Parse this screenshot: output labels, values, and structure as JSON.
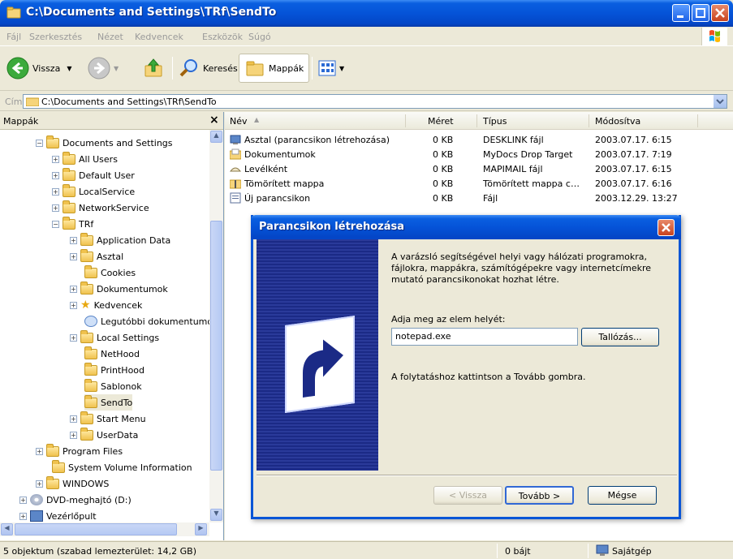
{
  "window": {
    "title": "C:\\Documents and Settings\\TRf\\SendTo"
  },
  "menu": [
    "Fájl",
    "Szerkesztés",
    "Nézet",
    "Kedvencek",
    "Eszközök",
    "Súgó"
  ],
  "toolbar": {
    "back_label": "Vissza",
    "search_label": "Keresés",
    "folders_label": "Mappák"
  },
  "address": {
    "label": "Cím",
    "value": "C:\\Documents and Settings\\TRf\\SendTo"
  },
  "left_pane": {
    "title": "Mappák",
    "close": "×",
    "tree": [
      {
        "label": "Documents and Settings",
        "expander": "−"
      },
      {
        "label": "All Users",
        "expander": "+"
      },
      {
        "label": "Default User",
        "expander": "+"
      },
      {
        "label": "LocalService",
        "expander": "+"
      },
      {
        "label": "NetworkService",
        "expander": "+"
      },
      {
        "label": "TRf",
        "expander": "−"
      },
      {
        "label": "Application Data",
        "expander": "+"
      },
      {
        "label": "Asztal",
        "expander": "+"
      },
      {
        "label": "Cookies",
        "expander": ""
      },
      {
        "label": "Dokumentumok",
        "expander": "+"
      },
      {
        "label": "Kedvencek",
        "expander": "+"
      },
      {
        "label": "Legutóbbi dokumentumo",
        "expander": ""
      },
      {
        "label": "Local Settings",
        "expander": "+"
      },
      {
        "label": "NetHood",
        "expander": ""
      },
      {
        "label": "PrintHood",
        "expander": ""
      },
      {
        "label": "Sablonok",
        "expander": ""
      },
      {
        "label": "SendTo",
        "expander": ""
      },
      {
        "label": "Start Menu",
        "expander": "+"
      },
      {
        "label": "UserData",
        "expander": "+"
      },
      {
        "label": "Program Files",
        "expander": "+"
      },
      {
        "label": "System Volume Information",
        "expander": ""
      },
      {
        "label": "WINDOWS",
        "expander": "+"
      },
      {
        "label": "DVD-meghajtó (D:)",
        "expander": "+"
      },
      {
        "label": "Vezérlőpult",
        "expander": "+"
      }
    ]
  },
  "file_list": {
    "columns": {
      "name": "Név",
      "size": "Méret",
      "type": "Típus",
      "modified": "Módosítva"
    },
    "rows": [
      {
        "name": "Asztal (parancsikon létrehozása)",
        "size": "0 KB",
        "type": "DESKLINK fájl",
        "modified": "2003.07.17. 6:15"
      },
      {
        "name": "Dokumentumok",
        "size": "0 KB",
        "type": "MyDocs Drop Target",
        "modified": "2003.07.17. 7:19"
      },
      {
        "name": "Levélként",
        "size": "0 KB",
        "type": "MAPIMAIL fájl",
        "modified": "2003.07.17. 6:15"
      },
      {
        "name": "Tömörített mappa",
        "size": "0 KB",
        "type": "Tömörített mappa c…",
        "modified": "2003.07.17. 6:16"
      },
      {
        "name": "Új parancsikon",
        "size": "0 KB",
        "type": "Fájl",
        "modified": "2003.12.29. 13:27"
      }
    ]
  },
  "dialog": {
    "title": "Parancsikon létrehozása",
    "description": "A varázsló segítségével helyi vagy hálózati programokra, fájlokra, mappákra, számítógépekre vagy internetcímekre mutató parancsikonokat hozhat létre.",
    "location_label": "Adja meg az elem helyét:",
    "location_value": "notepad.exe",
    "browse_button": "Tallózás...",
    "info": "A folytatáshoz kattintson a Tovább gombra.",
    "back_button": "< Vissza",
    "next_button": "Tovább >",
    "cancel_button": "Mégse"
  },
  "status": {
    "objects": "5 objektum  (szabad lemezterület: 14,2 GB)",
    "size": "0 bájt",
    "location": "Sajátgép"
  }
}
